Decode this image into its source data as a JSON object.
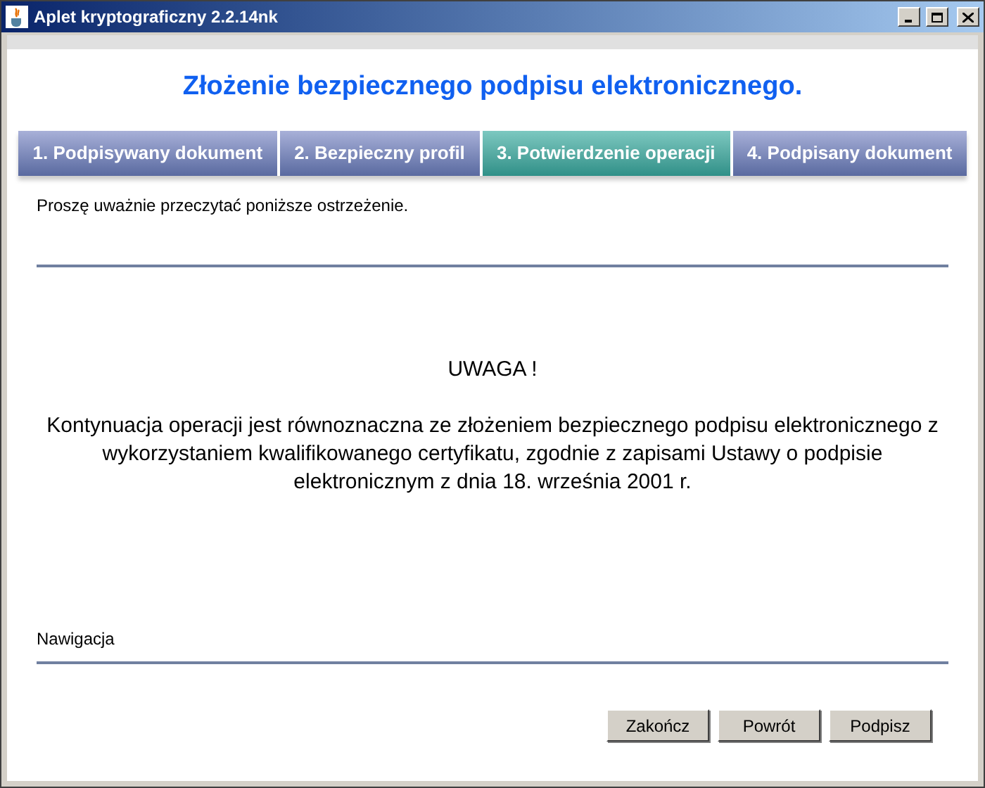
{
  "window": {
    "title": "Aplet kryptograficzny 2.2.14nk"
  },
  "heading": "Złożenie bezpiecznego podpisu elektronicznego.",
  "tabs": [
    {
      "label": "1. Podpisywany dokument",
      "selected": false
    },
    {
      "label": "2. Bezpieczny profil",
      "selected": false
    },
    {
      "label": "3. Potwierdzenie operacji",
      "selected": true
    },
    {
      "label": "4. Podpisany dokument",
      "selected": false
    }
  ],
  "intro": "Proszę uważnie przeczytać poniższe ostrzeżenie.",
  "warning": {
    "title": "UWAGA !",
    "text": "Kontynuacja operacji jest równoznaczna ze złożeniem bezpiecznego podpisu elektronicznego z wykorzystaniem kwalifikowanego certyfikatu, zgodnie z zapisami Ustawy o podpisie elektronicznym z dnia 18. września 2001 r."
  },
  "navigation": {
    "label": "Nawigacja",
    "buttons": [
      "Zakończ",
      "Powrót",
      "Podpisz"
    ]
  }
}
